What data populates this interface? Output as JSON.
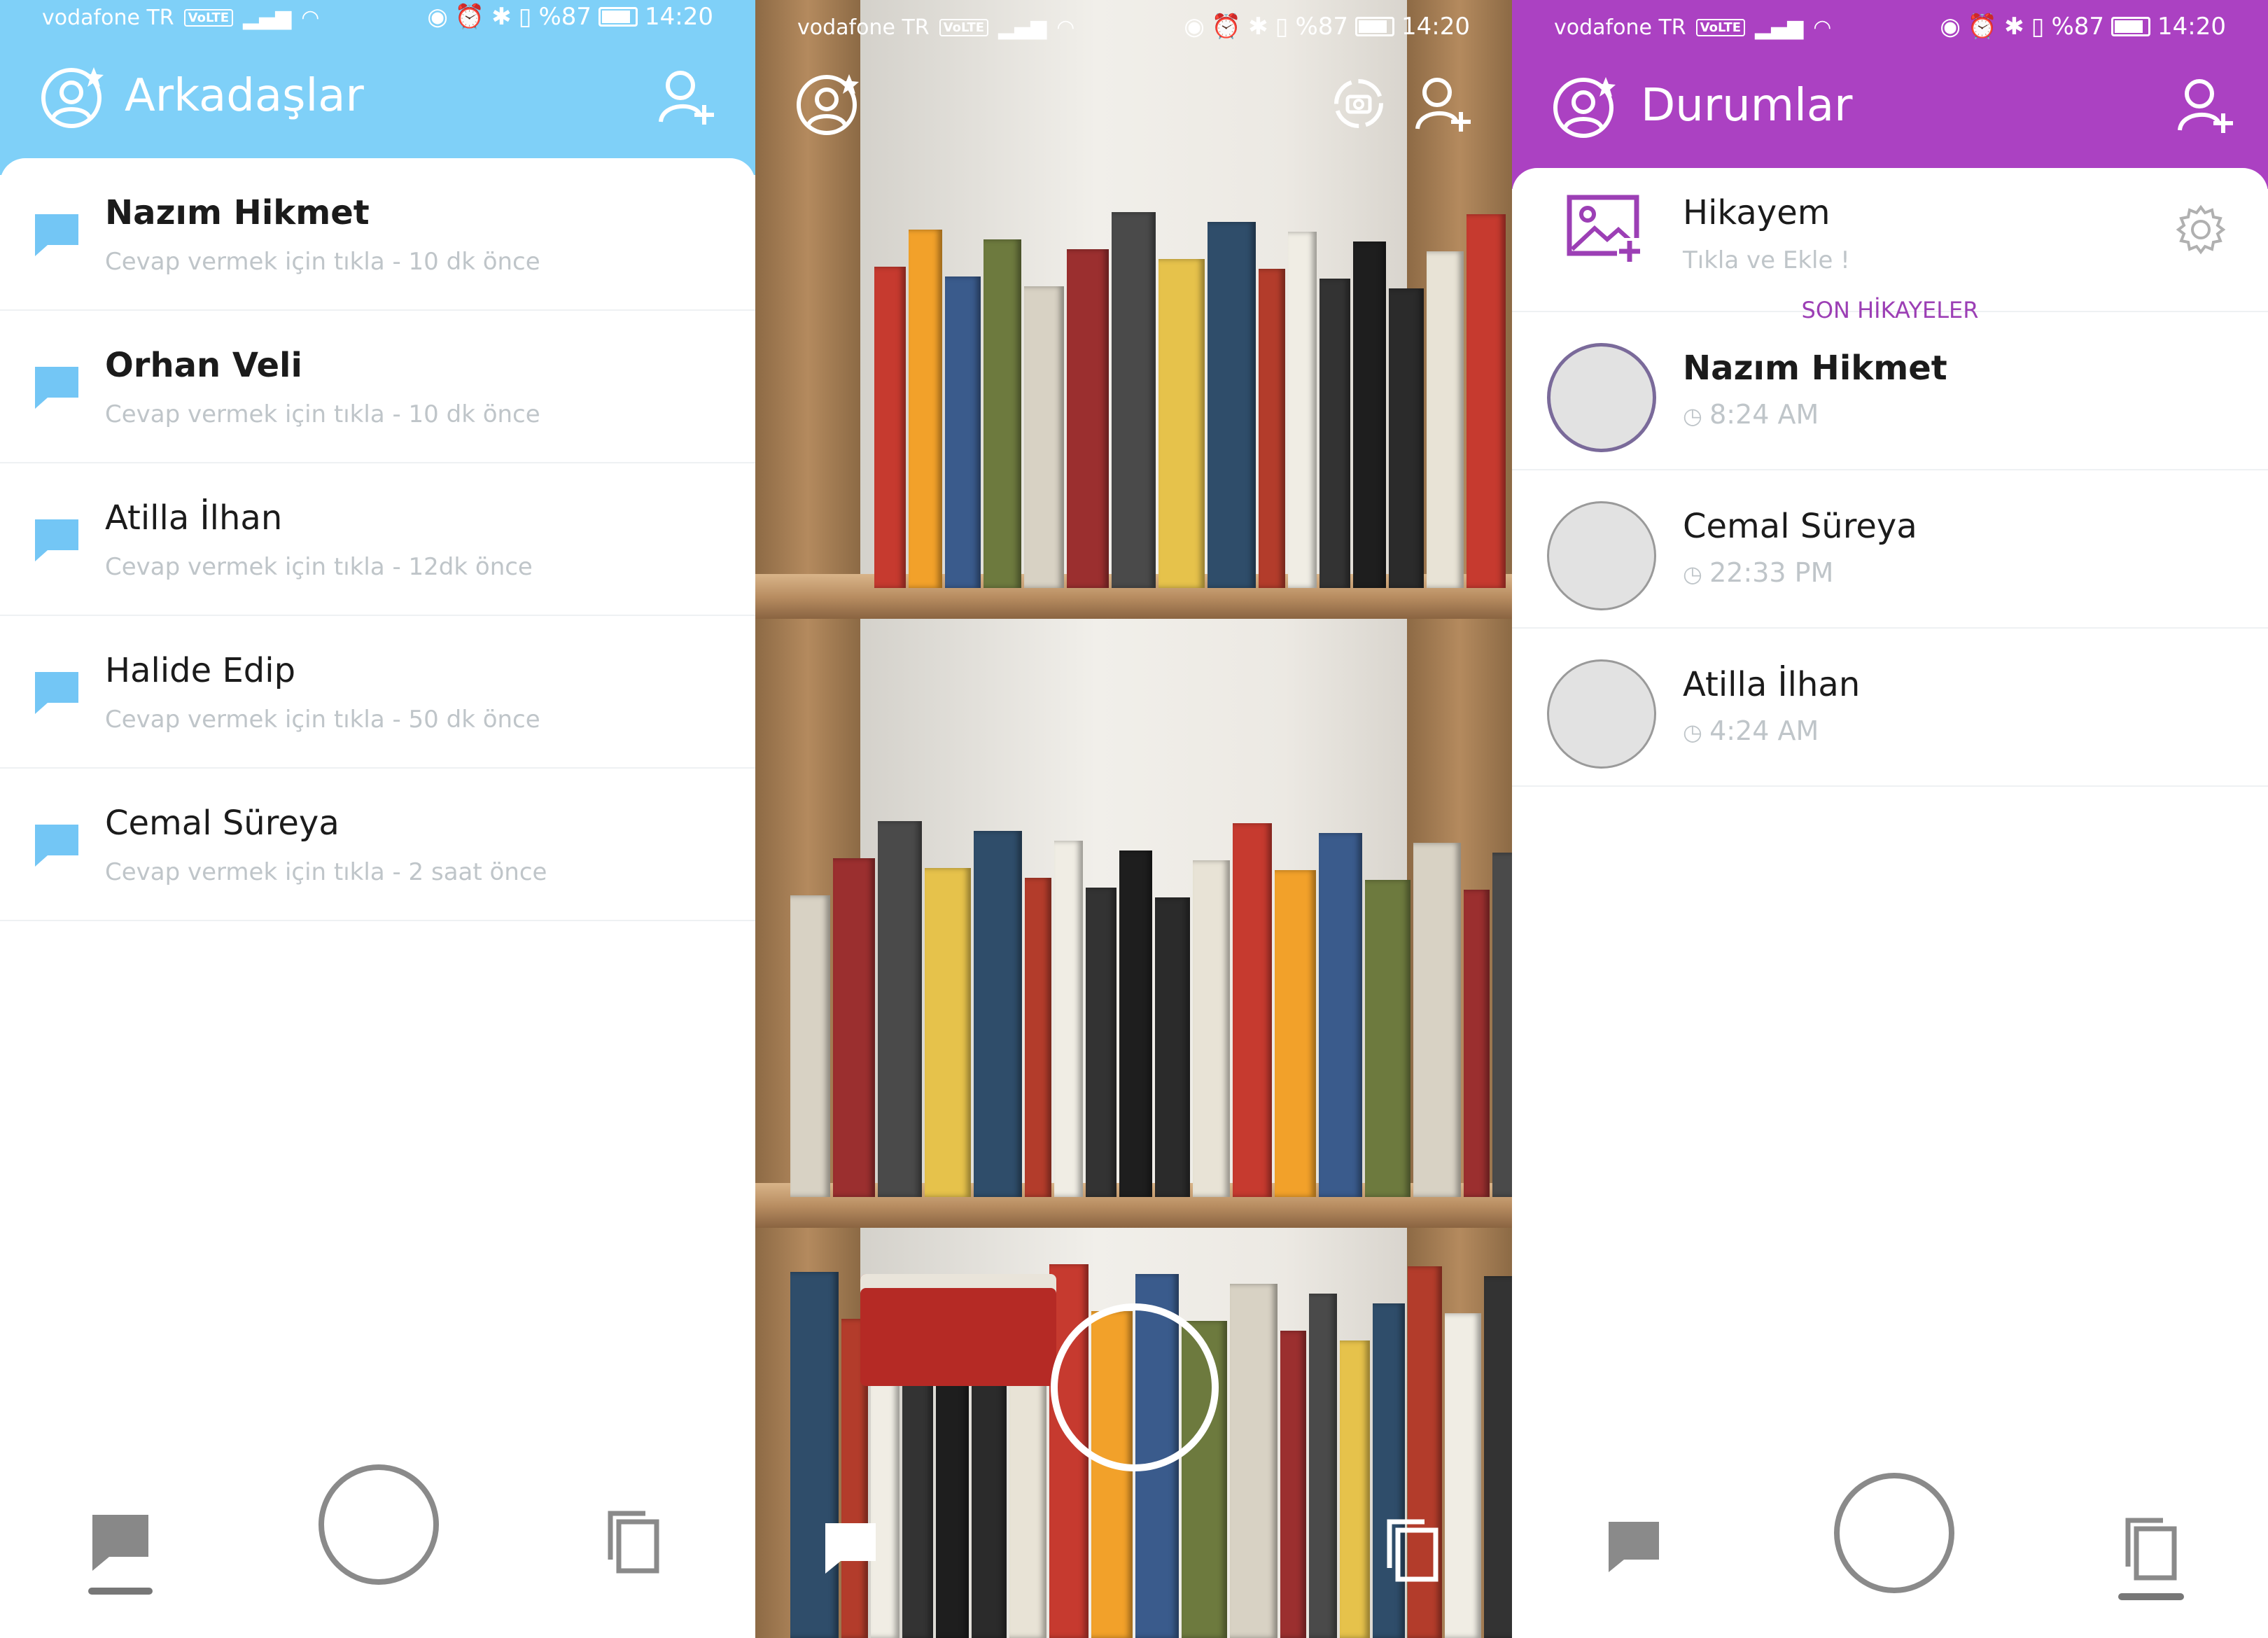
{
  "status_bar": {
    "carrier": "vodafone TR",
    "volte": "VoLTE",
    "battery": "%87",
    "time": "14:20"
  },
  "friends_screen": {
    "title": "Arkadaşlar",
    "header_color": "#7fd0f8",
    "accent_color": "#73c6f5",
    "contacts": [
      {
        "name": "Nazım Hikmet",
        "bold": true,
        "action": "Cevap vermek için tıkla - ",
        "time": "10 dk önce"
      },
      {
        "name": "Orhan Veli",
        "bold": true,
        "action": "Cevap vermek için tıkla - ",
        "time": "10 dk önce"
      },
      {
        "name": "Atilla İlhan",
        "bold": false,
        "action": "Cevap vermek için tıkla - ",
        "time": "12dk önce"
      },
      {
        "name": "Halide Edip",
        "bold": false,
        "action": "Cevap vermek için tıkla - ",
        "time": "50 dk önce"
      },
      {
        "name": "Cemal Süreya",
        "bold": false,
        "action": "Cevap vermek için tıkla - ",
        "time": "2 saat önce"
      }
    ]
  },
  "stories_screen": {
    "title": "Durumlar",
    "header_color": "#ab41c2",
    "accent_color": "#9c3fb5",
    "my_story": {
      "title": "Hikayem",
      "subtitle": "Tıkla ve Ekle !"
    },
    "section_label": "SON HİKAYELER",
    "stories": [
      {
        "name": "Nazım Hikmet",
        "bold": true,
        "time": "8:24 AM",
        "ring_color": "#7a6a9a"
      },
      {
        "name": "Cemal Süreya",
        "bold": false,
        "time": "22:33 PM",
        "ring_color": "#9a9a9a"
      },
      {
        "name": "Atilla İlhan",
        "bold": false,
        "time": "4:24 AM",
        "ring_color": "#9a9a9a"
      }
    ]
  }
}
